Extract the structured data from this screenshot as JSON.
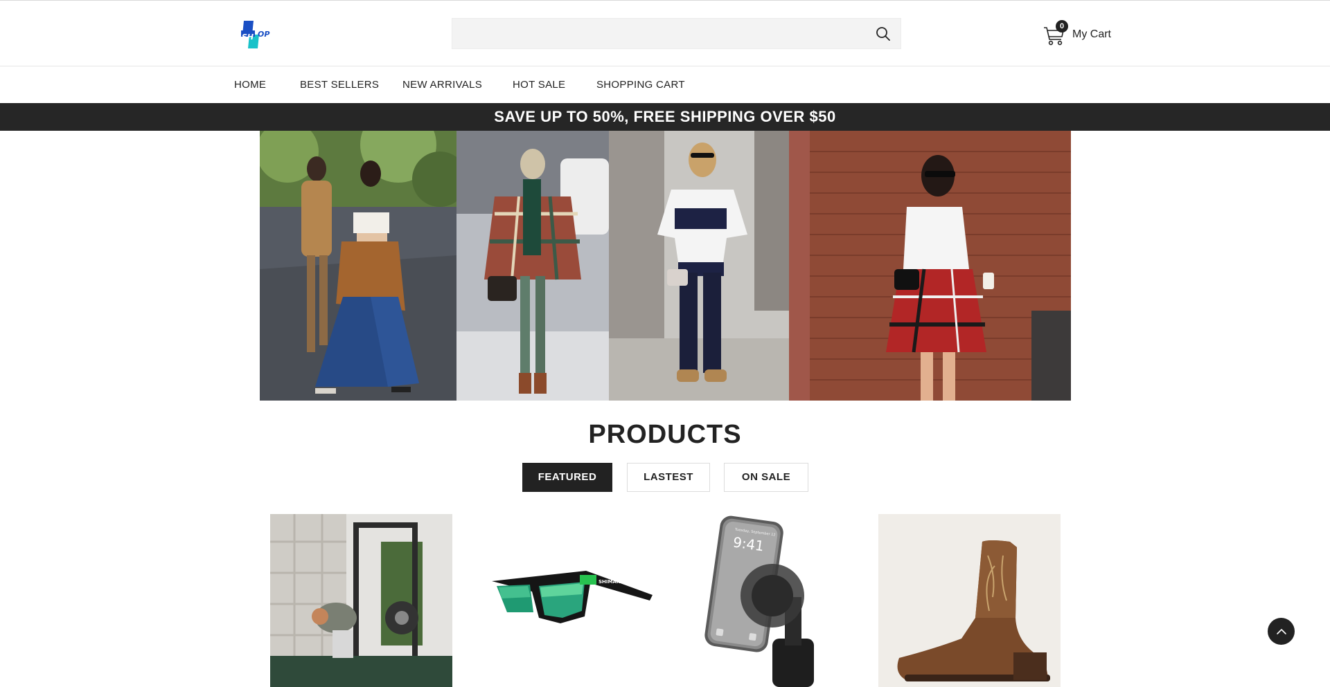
{
  "header": {
    "logo_text": "SHOP",
    "search": {
      "value": "",
      "placeholder": ""
    },
    "cart": {
      "count": "0",
      "label": "My Cart"
    }
  },
  "nav": {
    "items": [
      {
        "label": "HOME"
      },
      {
        "label": "BEST SELLERS"
      },
      {
        "label": "NEW ARRIVALS"
      },
      {
        "label": "HOT SALE"
      },
      {
        "label": "SHOPPING CART"
      }
    ]
  },
  "promo": {
    "text": "SAVE UP TO 50%, FREE SHIPPING OVER $50"
  },
  "hero": {
    "photos": [
      "street-style-two-women",
      "plaid-poncho-woman",
      "striped-tee-woman",
      "plaid-skirt-woman"
    ]
  },
  "products": {
    "title": "PRODUCTS",
    "tabs": [
      {
        "label": "FEATURED",
        "active": true
      },
      {
        "label": "LASTEST",
        "active": false
      },
      {
        "label": "ON SALE",
        "active": false
      }
    ],
    "items": [
      {
        "image": "home-gym-cable-machine"
      },
      {
        "image": "green-mirrored-sunglasses",
        "brand_mark": "SHIMANO"
      },
      {
        "image": "magnetic-phone-mount",
        "phone_time": "9:41",
        "phone_date": "Tuesday, September 12"
      },
      {
        "image": "brown-western-boot"
      }
    ]
  },
  "colors": {
    "accent": "#222222",
    "promo_bg": "#262626",
    "logo_blue": "#1a4fc4",
    "logo_teal": "#19c2c9"
  }
}
